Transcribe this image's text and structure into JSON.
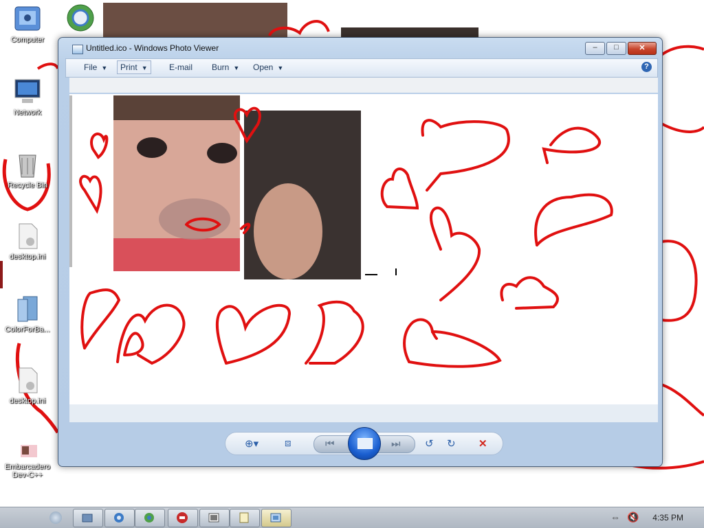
{
  "desktop": {
    "icons": [
      {
        "label": "Computer"
      },
      {
        "label": "Network"
      },
      {
        "label": "Recycle Bin"
      },
      {
        "label": "desktop.ini"
      },
      {
        "label": "ColorForBa..."
      },
      {
        "label": "desktop.ini"
      },
      {
        "label": "Embarcadero\nDev-C++"
      }
    ]
  },
  "window": {
    "title": "Untitled.ico - Windows Photo Viewer",
    "buttons": {
      "minimize": "–",
      "maximize": "□",
      "close": "✕"
    },
    "menu": {
      "file": "File",
      "print": "Print",
      "email": "E-mail",
      "burn": "Burn",
      "open": "Open",
      "help": "?"
    },
    "controls": {
      "zoom": "⊕▾",
      "fit": "⧈",
      "previous": "⏮",
      "next": "⏭",
      "rotate_ccw": "↺",
      "rotate_cw": "↻",
      "delete": "✕"
    }
  },
  "taskbar": {
    "clock": "4:35 PM",
    "start_glyph": ""
  },
  "colors": {
    "scribble": "#e01010",
    "window_frame": "#b9cfe8",
    "delete": "#d2261c",
    "accent": "#2a5ea8"
  }
}
